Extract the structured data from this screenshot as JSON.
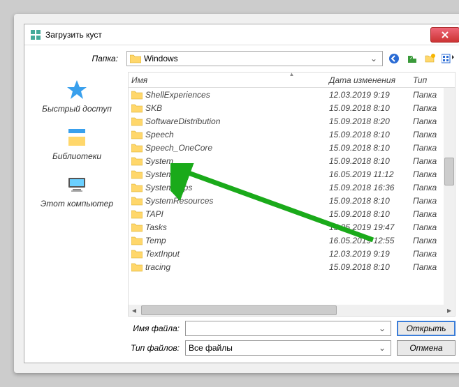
{
  "title": "Загрузить куст",
  "folder_label": "Папка:",
  "folder_selected": "Windows",
  "toolbar_icons": [
    "back",
    "up",
    "newfolder",
    "views"
  ],
  "places": [
    {
      "id": "quick",
      "label": "Быстрый доступ"
    },
    {
      "id": "libs",
      "label": "Библиотеки"
    },
    {
      "id": "thispc",
      "label": "Этот компьютер"
    }
  ],
  "columns": {
    "c1": "Имя",
    "c2": "Дата изменения",
    "c3": "Тип"
  },
  "rows": [
    {
      "n": "ShellExperiences",
      "d": "12.03.2019 9:19",
      "t": "Папка"
    },
    {
      "n": "SKB",
      "d": "15.09.2018 8:10",
      "t": "Папка"
    },
    {
      "n": "SoftwareDistribution",
      "d": "15.09.2018 8:20",
      "t": "Папка"
    },
    {
      "n": "Speech",
      "d": "15.09.2018 8:10",
      "t": "Папка"
    },
    {
      "n": "Speech_OneCore",
      "d": "15.09.2018 8:10",
      "t": "Папка"
    },
    {
      "n": "System",
      "d": "15.09.2018 8:10",
      "t": "Папка"
    },
    {
      "n": "System32",
      "d": "16.05.2019 11:12",
      "t": "Папка"
    },
    {
      "n": "SystemApps",
      "d": "15.09.2018 16:36",
      "t": "Папка"
    },
    {
      "n": "SystemResources",
      "d": "15.09.2018 8:10",
      "t": "Папка"
    },
    {
      "n": "TAPI",
      "d": "15.09.2018 8:10",
      "t": "Папка"
    },
    {
      "n": "Tasks",
      "d": "15.05.2019 19:47",
      "t": "Папка"
    },
    {
      "n": "Temp",
      "d": "16.05.2019 12:55",
      "t": "Папка"
    },
    {
      "n": "TextInput",
      "d": "12.03.2019 9:19",
      "t": "Папка"
    },
    {
      "n": "tracing",
      "d": "15.09.2018 8:10",
      "t": "Папка"
    }
  ],
  "filename_label": "Имя файла:",
  "filetype_label": "Тип файлов:",
  "filetype_value": "Все файлы",
  "open_label": "Открыть",
  "cancel_label": "Отмена"
}
